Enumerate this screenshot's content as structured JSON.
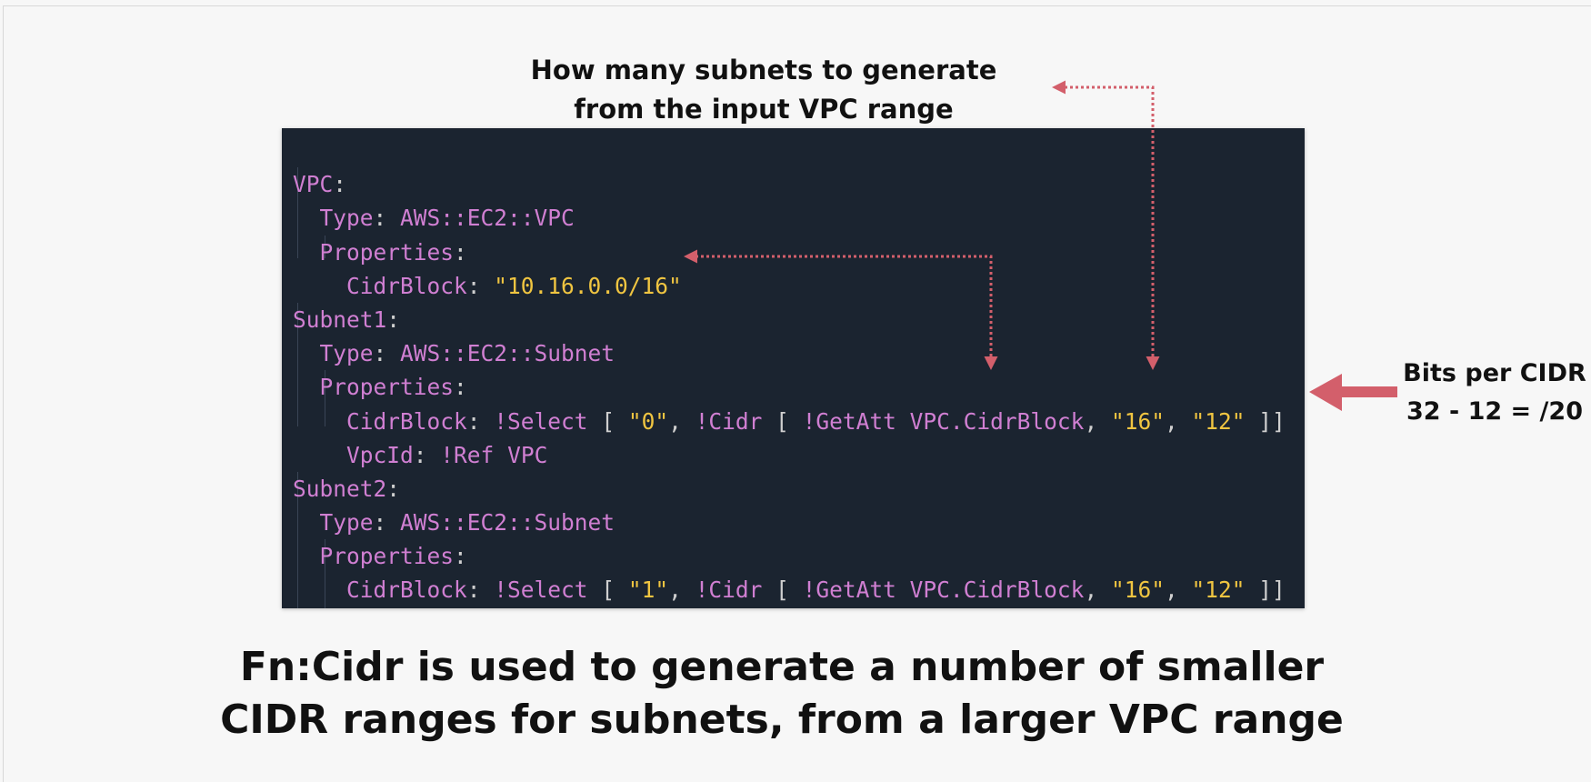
{
  "annotations": {
    "subnets_line1": "How many subnets to generate",
    "subnets_line2": "from the input VPC range",
    "bits_line1": "Bits per CIDR",
    "bits_line2": "32 - 12 = /20"
  },
  "caption": {
    "line1": "Fn:Cidr is used to generate a number of smaller",
    "line2": "CIDR ranges for subnets, from a larger VPC range"
  },
  "code": {
    "vpc": "VPC",
    "type_key": "Type",
    "vpc_type": "AWS::EC2::VPC",
    "properties_key": "Properties",
    "cidrblock_key": "CidrBlock",
    "vpc_cidr": "\"10.16.0.0/16\"",
    "subnet1": "Subnet1",
    "subnet2": "Subnet2",
    "subnet_type": "AWS::EC2::Subnet",
    "select_fn": "!Select",
    "index0": "\"0\"",
    "index1": "\"1\"",
    "cidr_fn": "!Cidr",
    "getatt_fn": "!GetAtt",
    "getatt_target": "VPC.CidrBlock",
    "count": "\"16\"",
    "bits": "\"12\"",
    "vpcid_key": "VpcId",
    "ref_fn": "!Ref",
    "ref_target": "VPC"
  },
  "colors": {
    "code_background": "#1b2430",
    "keyword": "#d07fd2",
    "string": "#f0c541",
    "arrow": "#d35f6b"
  }
}
